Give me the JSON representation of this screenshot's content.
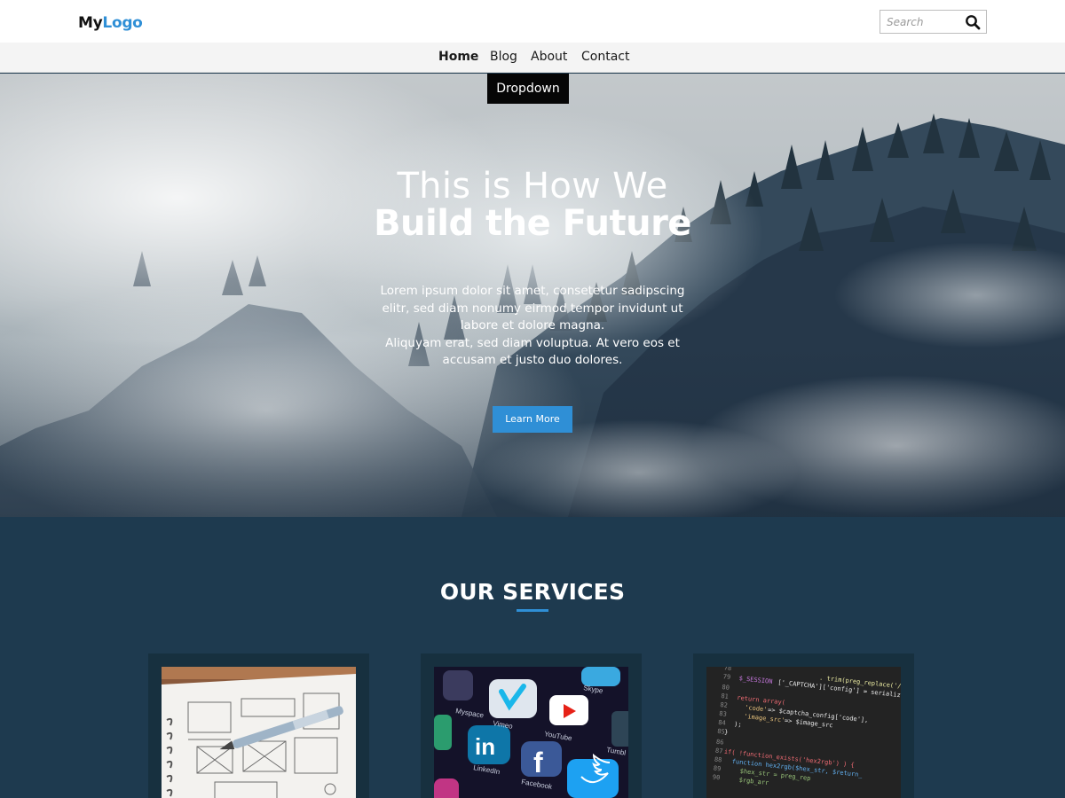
{
  "header": {
    "logo_part1": "My",
    "logo_part2": "Logo",
    "search_placeholder": "Search"
  },
  "nav": {
    "items": [
      "Home",
      "Blog",
      "About",
      "Contact"
    ],
    "active": "Home",
    "dropdown_label": "Dropdown"
  },
  "hero": {
    "title_line1": "This is How We",
    "title_line2": "Build the Future",
    "paragraph1": "Lorem ipsum dolor sit amet, consetetur sadipscing elitr, sed diam nonumy eirmod tempor invidunt ut labore et dolore magna.",
    "paragraph2": "Aliquyam erat, sed diam voluptua. At vero eos et accusam et justo duo dolores.",
    "button_label": "Learn More"
  },
  "services": {
    "title": "OUR SERVICES",
    "cards": [
      {
        "image": "wireframe-sketch-photo"
      },
      {
        "image": "social-media-apps-photo",
        "app_labels": [
          "Vimeo",
          "YouTube",
          "LinkedIn",
          "Facebook",
          "Tumblr",
          "Skype",
          "Myspace"
        ]
      },
      {
        "image": "php-code-photo",
        "code_lines": [
          "$_SESSION['_CAPTCHA']['config'] = serialize(",
          "return array(",
          "'code' => $captcha_config['code'],",
          "'image_src' => $image_src",
          ");",
          "}",
          "if( !function_exists('hex2rgb') ) {",
          "function hex2rgb($hex_str, $return_",
          "$hex_str = preg_rep"
        ]
      }
    ]
  },
  "colors": {
    "accent": "#2f8fd6",
    "services_bg": "#1e3a4f",
    "card_bg": "#17303f",
    "dropdown_bg": "#060606"
  }
}
